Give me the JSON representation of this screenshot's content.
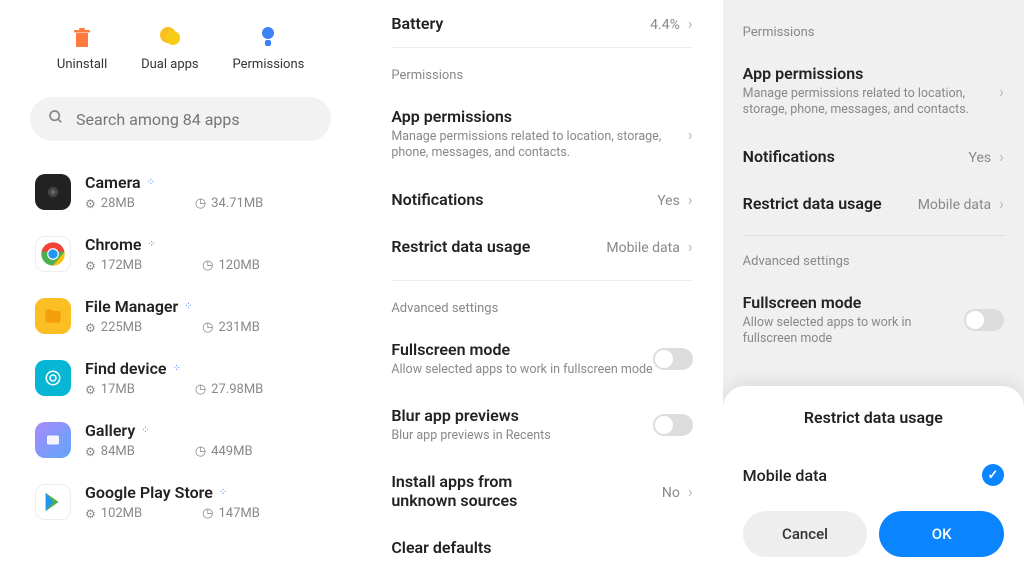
{
  "actions": {
    "uninstall": "Uninstall",
    "dual_apps": "Dual apps",
    "permissions": "Permissions"
  },
  "search": {
    "placeholder": "Search among 84 apps"
  },
  "apps": [
    {
      "name": "Camera",
      "storage": "28MB",
      "time": "34.71MB"
    },
    {
      "name": "Chrome",
      "storage": "172MB",
      "time": "120MB"
    },
    {
      "name": "File Manager",
      "storage": "225MB",
      "time": "231MB"
    },
    {
      "name": "Find device",
      "storage": "17MB",
      "time": "27.98MB"
    },
    {
      "name": "Gallery",
      "storage": "84MB",
      "time": "449MB"
    },
    {
      "name": "Google Play Store",
      "storage": "102MB",
      "time": "147MB"
    }
  ],
  "battery": {
    "label": "Battery",
    "value": "4.4%"
  },
  "sections": {
    "permissions": "Permissions",
    "advanced": "Advanced settings"
  },
  "settings": {
    "app_permissions": {
      "title": "App permissions",
      "desc": "Manage permissions related to location, storage, phone, messages, and contacts."
    },
    "notifications": {
      "title": "Notifications",
      "value": "Yes"
    },
    "restrict_data": {
      "title": "Restrict data usage",
      "value": "Mobile data"
    },
    "fullscreen": {
      "title": "Fullscreen mode",
      "desc": "Allow selected apps to work in fullscreen mode"
    },
    "blur": {
      "title": "Blur app previews",
      "desc": "Blur app previews in Recents"
    },
    "install_unknown": {
      "title": "Install apps from unknown sources",
      "value": "No"
    },
    "clear_defaults": {
      "title": "Clear defaults"
    }
  },
  "dialog": {
    "title": "Restrict data usage",
    "option_mobile": "Mobile data",
    "cancel": "Cancel",
    "ok": "OK"
  }
}
